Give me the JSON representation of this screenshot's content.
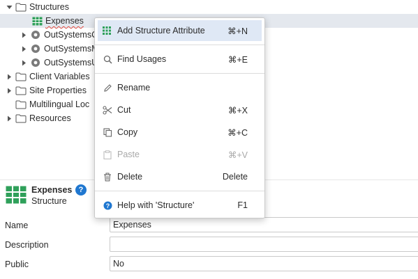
{
  "tree": {
    "items": [
      {
        "label": "Structures",
        "icon": "folder-icon",
        "arrow": "expanded"
      },
      {
        "label": "Expenses",
        "icon": "structure-icon",
        "arrow": "none"
      },
      {
        "label": "OutSystemsC",
        "icon": "module-icon",
        "arrow": "collapsed"
      },
      {
        "label": "OutSystemsM",
        "icon": "module-icon",
        "arrow": "collapsed"
      },
      {
        "label": "OutSystemsU",
        "icon": "module-icon",
        "arrow": "collapsed"
      },
      {
        "label": "Client Variables",
        "icon": "folder-icon",
        "arrow": "collapsed"
      },
      {
        "label": "Site Properties",
        "icon": "folder-icon",
        "arrow": "collapsed"
      },
      {
        "label": "Multilingual Loc",
        "icon": "folder-icon",
        "arrow": "none"
      },
      {
        "label": "Resources",
        "icon": "folder-icon",
        "arrow": "collapsed"
      }
    ]
  },
  "context_menu": {
    "items": [
      {
        "label": "Add Structure Attribute",
        "shortcut": "⌘+N",
        "icon": "add-attribute-icon",
        "highlighted": true,
        "enabled": true
      },
      {
        "label": "Find Usages",
        "shortcut": "⌘+E",
        "icon": "search-icon",
        "enabled": true
      },
      {
        "label": "Rename",
        "shortcut": "",
        "icon": "pencil-icon",
        "enabled": true
      },
      {
        "label": "Cut",
        "shortcut": "⌘+X",
        "icon": "scissors-icon",
        "enabled": true
      },
      {
        "label": "Copy",
        "shortcut": "⌘+C",
        "icon": "copy-icon",
        "enabled": true
      },
      {
        "label": "Paste",
        "shortcut": "⌘+V",
        "icon": "paste-icon",
        "enabled": false
      },
      {
        "label": "Delete",
        "shortcut": "Delete",
        "icon": "trash-icon",
        "enabled": true
      },
      {
        "label": "Help with 'Structure'",
        "shortcut": "F1",
        "icon": "help-icon",
        "enabled": true
      }
    ]
  },
  "properties": {
    "title": "Expenses",
    "subtitle": "Structure",
    "help_glyph": "?",
    "fields": [
      {
        "label": "Name",
        "value": "Expenses"
      },
      {
        "label": "Description",
        "value": ""
      },
      {
        "label": "Public",
        "value": "No"
      }
    ]
  },
  "colors": {
    "accent": "#1f77d0",
    "structure_green": "#2fa05a",
    "menu_highlight": "#dfe8f5",
    "selection": "#e4e8ee"
  }
}
